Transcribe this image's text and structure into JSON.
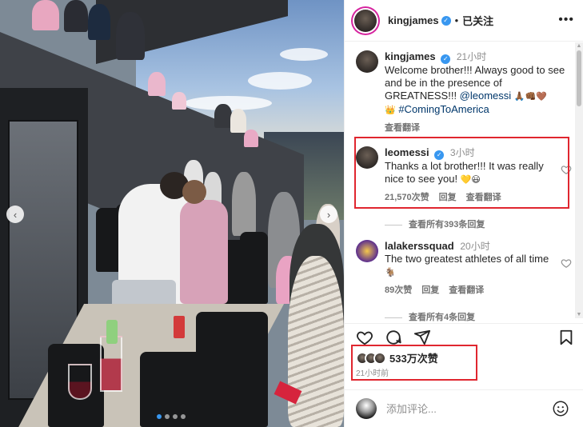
{
  "post": {
    "username": "kingjames",
    "separator": "•",
    "follow_state": "已关注",
    "more_icon": "more-horizontal-icon"
  },
  "caption": {
    "username": "kingjames",
    "time": "21小时",
    "text": "Welcome brother!!! Always good to see and be in the presence of GREATNESS!!! ",
    "mention": "@leomessi",
    "emoji_1": "🙏🏾👊🏾🤎",
    "crown": "👑",
    "hashtag": "#ComingToAmerica",
    "translate": "查看翻译"
  },
  "comments": [
    {
      "username": "leomessi",
      "time": "3小时",
      "text": "Thanks a lot brother!!! It was really nice to see you! ",
      "emoji": "💛😃",
      "likes": "21,570次赞",
      "reply": "回复",
      "translate": "查看翻译",
      "view_replies": "查看所有393条回复"
    },
    {
      "username": "lalakerssquad",
      "time": "20小时",
      "text": "The two greatest athletes of all time ",
      "emoji": "🐐",
      "likes": "89次赞",
      "reply": "回复",
      "translate": "查看翻译",
      "view_replies": "查看所有4条回复"
    }
  ],
  "engagement": {
    "likes": "533万次赞",
    "posted": "21小时前"
  },
  "add_comment": {
    "placeholder": "添加评论..."
  },
  "colors": {
    "highlight_box": "#e0262f",
    "verified": "#3897f0",
    "link": "#00376b"
  }
}
